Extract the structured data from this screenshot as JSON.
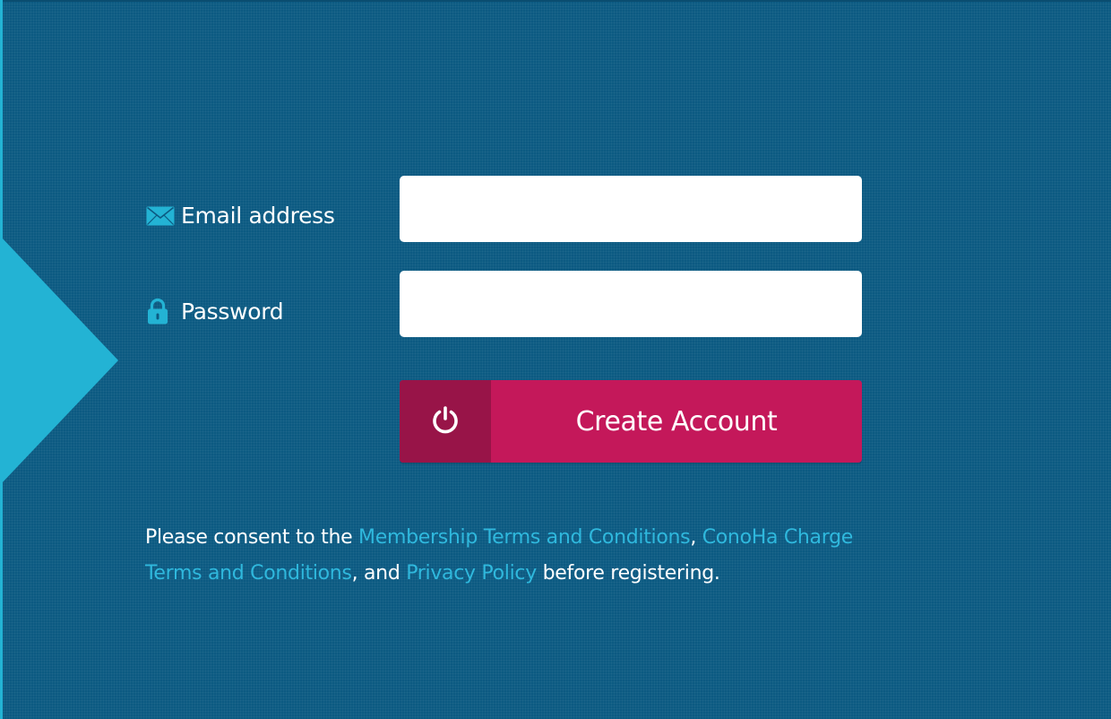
{
  "form": {
    "email": {
      "label": "Email address",
      "icon": "envelope-icon",
      "value": "",
      "placeholder": ""
    },
    "password": {
      "label": "Password",
      "icon": "lock-icon",
      "value": "",
      "placeholder": ""
    },
    "submit": {
      "label": "Create Account",
      "icon": "power-icon"
    }
  },
  "consent": {
    "prefix": "Please consent to the ",
    "link_membership": "Membership Terms and Conditions",
    "sep1": ", ",
    "link_charge": "ConoHa Charge Terms and Conditions",
    "sep2": ", and ",
    "link_privacy": "Privacy Policy",
    "suffix": " before registering."
  },
  "colors": {
    "background": "#0c5a82",
    "accent_cyan": "#23b3d4",
    "link": "#2fb8dd",
    "button": "#c4185a",
    "button_icon_bg": "#981448"
  }
}
